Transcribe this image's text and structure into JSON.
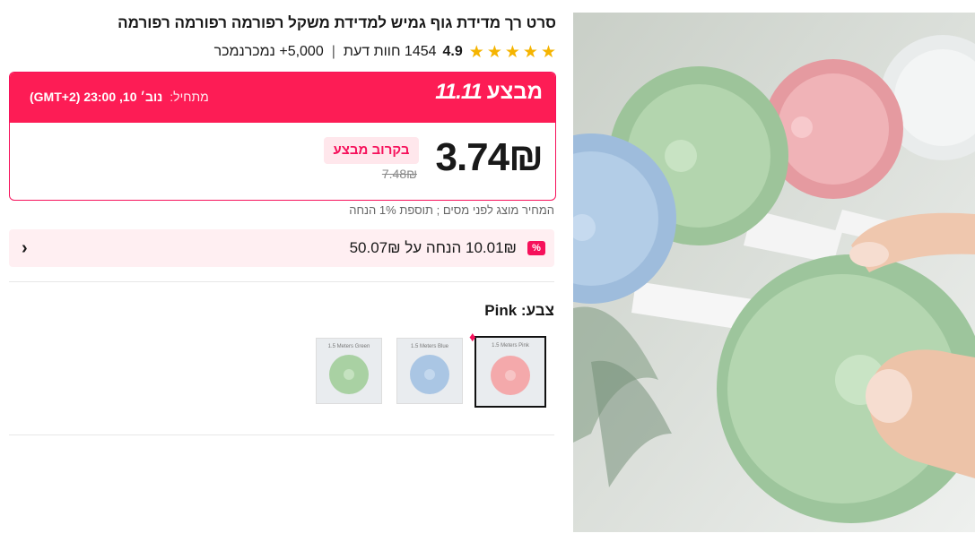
{
  "product": {
    "title": "סרט רך מדידת גוף גמיש למדידת משקל רפורמה רפורמה רפורמה",
    "rating": "4.9",
    "reviews": "1454 חוות דעת",
    "separator": "|",
    "sold": "5,000+ נמכרנמכר",
    "stars": 5
  },
  "deal": {
    "brand_word": "מבצע",
    "brand_event": "11.11",
    "start_label": "מתחיל:",
    "start_value": "נוב׳ 10, 23:00 (GMT+2)",
    "price": "3.74₪",
    "soon_badge": "בקרוב מבצע",
    "old_price": "7.48₪",
    "accent_color": "#fd1c55"
  },
  "tax_note": "המחיר מוצג לפני מסים ; תוספת 1% הנחה",
  "coupon": {
    "badge": "%",
    "text": "10.01₪ הנחה על 50.07₪",
    "chevron": "›"
  },
  "color": {
    "label": "צבע: Pink",
    "options": [
      {
        "caption": "1.5 Meters Pink",
        "color": "#f4a9ab",
        "selected": true
      },
      {
        "caption": "1.5 Meters Blue",
        "color": "#aac6e4",
        "selected": false
      },
      {
        "caption": "1.5 Meters Green",
        "color": "#a9d1a3",
        "selected": false
      }
    ]
  },
  "icons": {
    "star": "star-icon",
    "flame": "flame-icon",
    "chevron": "chevron-left-icon"
  }
}
